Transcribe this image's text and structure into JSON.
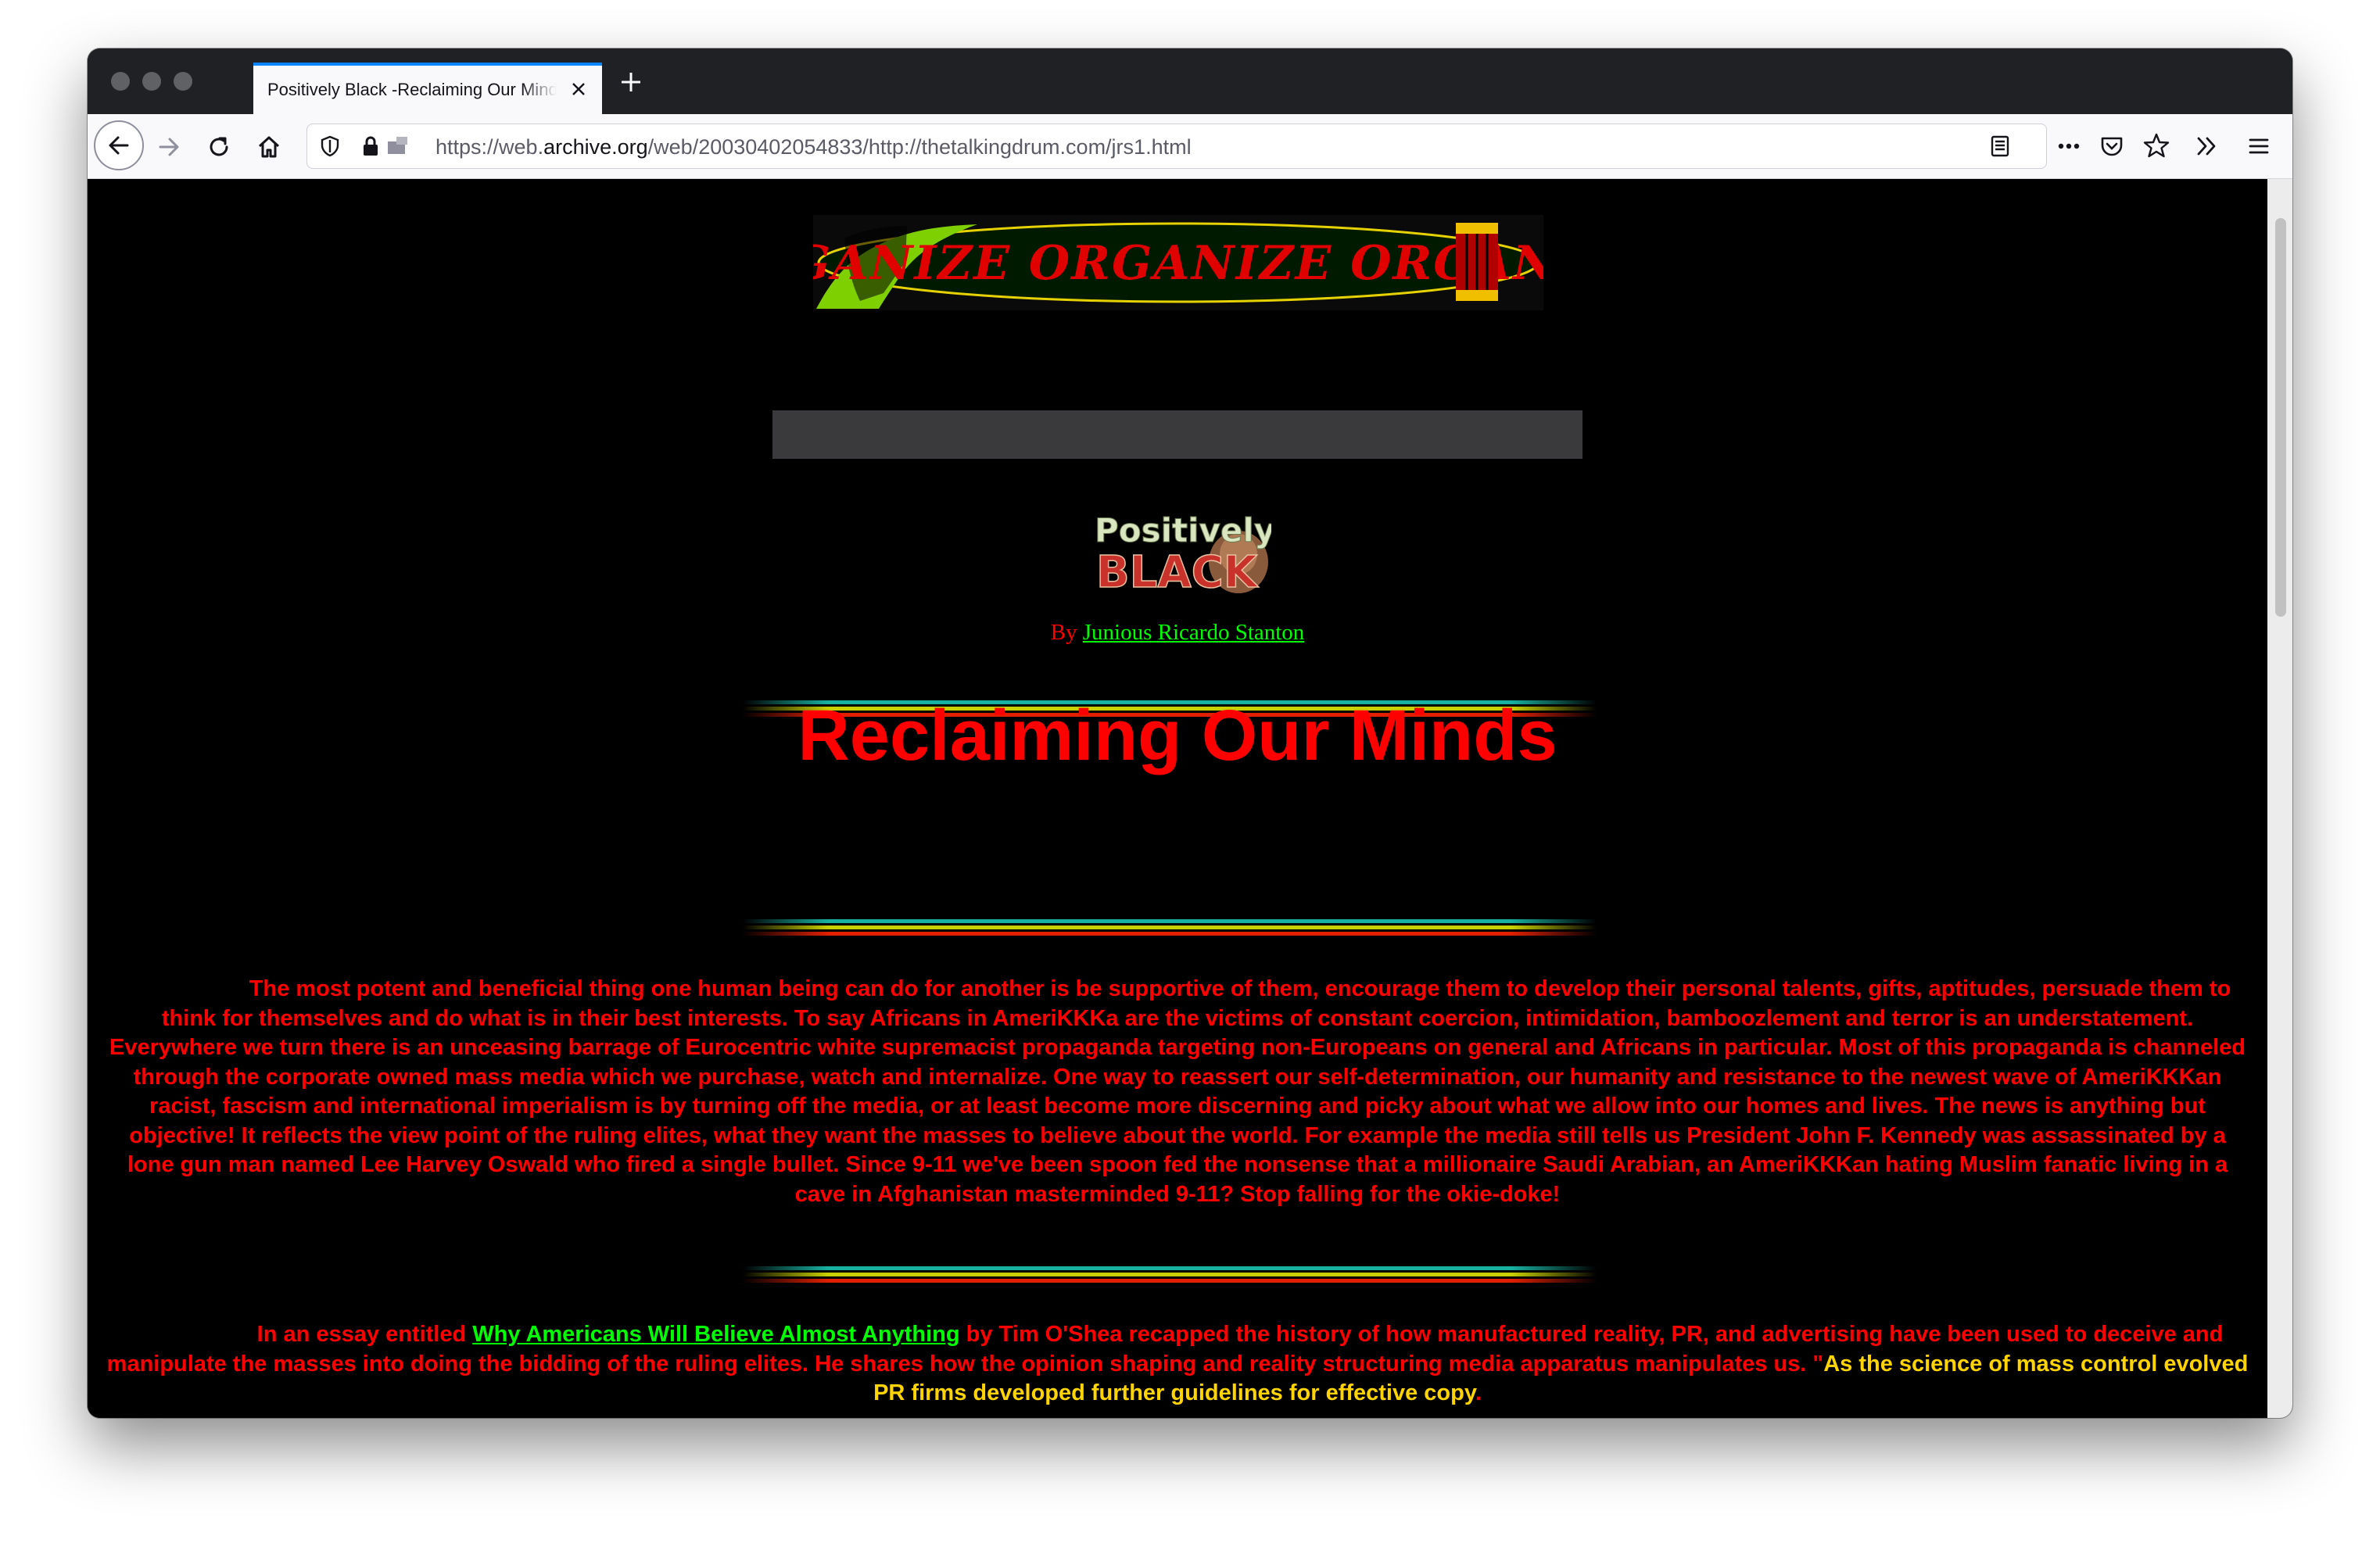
{
  "browser": {
    "tab_title": "Positively Black -Reclaiming Our Minds",
    "url_prefix": "https://web.",
    "url_domain": "archive.org",
    "url_path": "/web/20030402054833/http://thetalkingdrum.com/jrs1.html"
  },
  "page": {
    "banner_text": "ORGANIZE ORGANIZE ORGANIZE",
    "logo_line1": "Positively",
    "logo_line2": "BLACK",
    "byline_prefix": "By ",
    "author": "Junious Ricardo Stanton",
    "headline": "Reclaiming Our Minds",
    "para1": "The most potent and beneficial thing one human being can do for another is be supportive of them, encourage them to develop their personal talents, gifts, aptitudes, persuade them to think for themselves and do what is in their best interests. To say Africans in AmeriKKKa are the victims of constant coercion, intimidation, bamboozlement and terror is an understatement. Everywhere we turn there is an unceasing barrage of Eurocentric white supremacist propaganda targeting non-Europeans on general and Africans in particular. Most of this propaganda is channeled through the corporate owned mass media which we purchase, watch and internalize. One way to reassert our self-determination, our humanity and resistance to the newest wave of AmeriKKKan racist, fascism and international imperialism is by turning off the media, or at least become more discerning and picky about what we allow into our homes and lives. The news is anything but objective! It reflects the view point of the ruling elites, what they want the masses to believe about the world. For example the media still tells us President John F. Kennedy was assassinated by a lone gun man named Lee Harvey Oswald who fired a single bullet. Since 9-11 we've been spoon fed the nonsense that a millionaire Saudi Arabian, an AmeriKKKan hating Muslim fanatic living in a cave in Afghanistan masterminded 9-11?  Stop falling for the okie-doke!",
    "para2_lead": "In an essay entitled ",
    "para2_link": "Why Americans Will Believe Almost Anything",
    "para2_body": " by Tim O'Shea recapped the history of how manufactured reality, PR, and advertising have been used to deceive and manipulate the masses into doing the bidding of the ruling elites. He shares how the opinion shaping and reality structuring media apparatus manipulates us. \"",
    "para2_quote": "As the science of mass control evolved PR firms developed further guidelines for effective copy",
    "para2_end": "."
  },
  "colors": {
    "text_red": "#ff0000",
    "link_green": "#00ff00",
    "quote_yellow": "#ffd400",
    "background": "#000000"
  }
}
